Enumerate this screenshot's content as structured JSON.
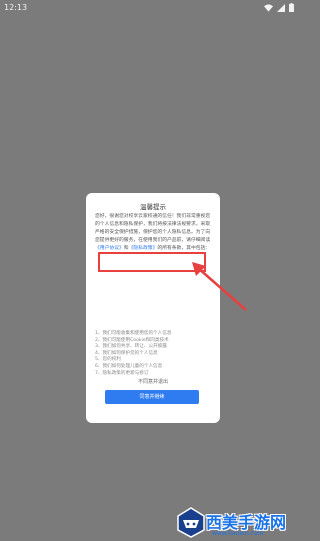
{
  "status_bar": {
    "time": "12:13"
  },
  "dialog": {
    "title": "温馨提示",
    "body_prefix": "您好，很谢您对校享云家校通的信任！我们非常重视您的个人信息和隐私保护，我们将按法律法规要求，采取严格的安全保护措施，保护您的个人隐私信息。为了向您提供更好的服务，在使用我们的产品前，请仔细阅读",
    "user_agreement_link": "《用户协议》",
    "body_middle": "和",
    "privacy_policy_link": "《隐私政策》",
    "body_suffix": "的所有条款，其中包括：",
    "list_items": [
      "1、我们可能收集和使用您的个人信息",
      "2、我们可能使用Cookie和同类技术",
      "3、我们如何共享、转让、公开披露",
      "4、我们如何保护您的个人信息",
      "5、您的权利",
      "6、我们如何处理儿童的个人信息",
      "7、隐私政策的更新与修订"
    ],
    "disagree_label": "不同意并退出",
    "agree_label": "同意并继续"
  },
  "colors": {
    "backdrop": "#7b7b7b",
    "accent": "#2f7bf0",
    "annotation": "#e83f3f"
  },
  "watermark": {
    "text": "西美手游网",
    "url": "www.hanxm.com"
  }
}
